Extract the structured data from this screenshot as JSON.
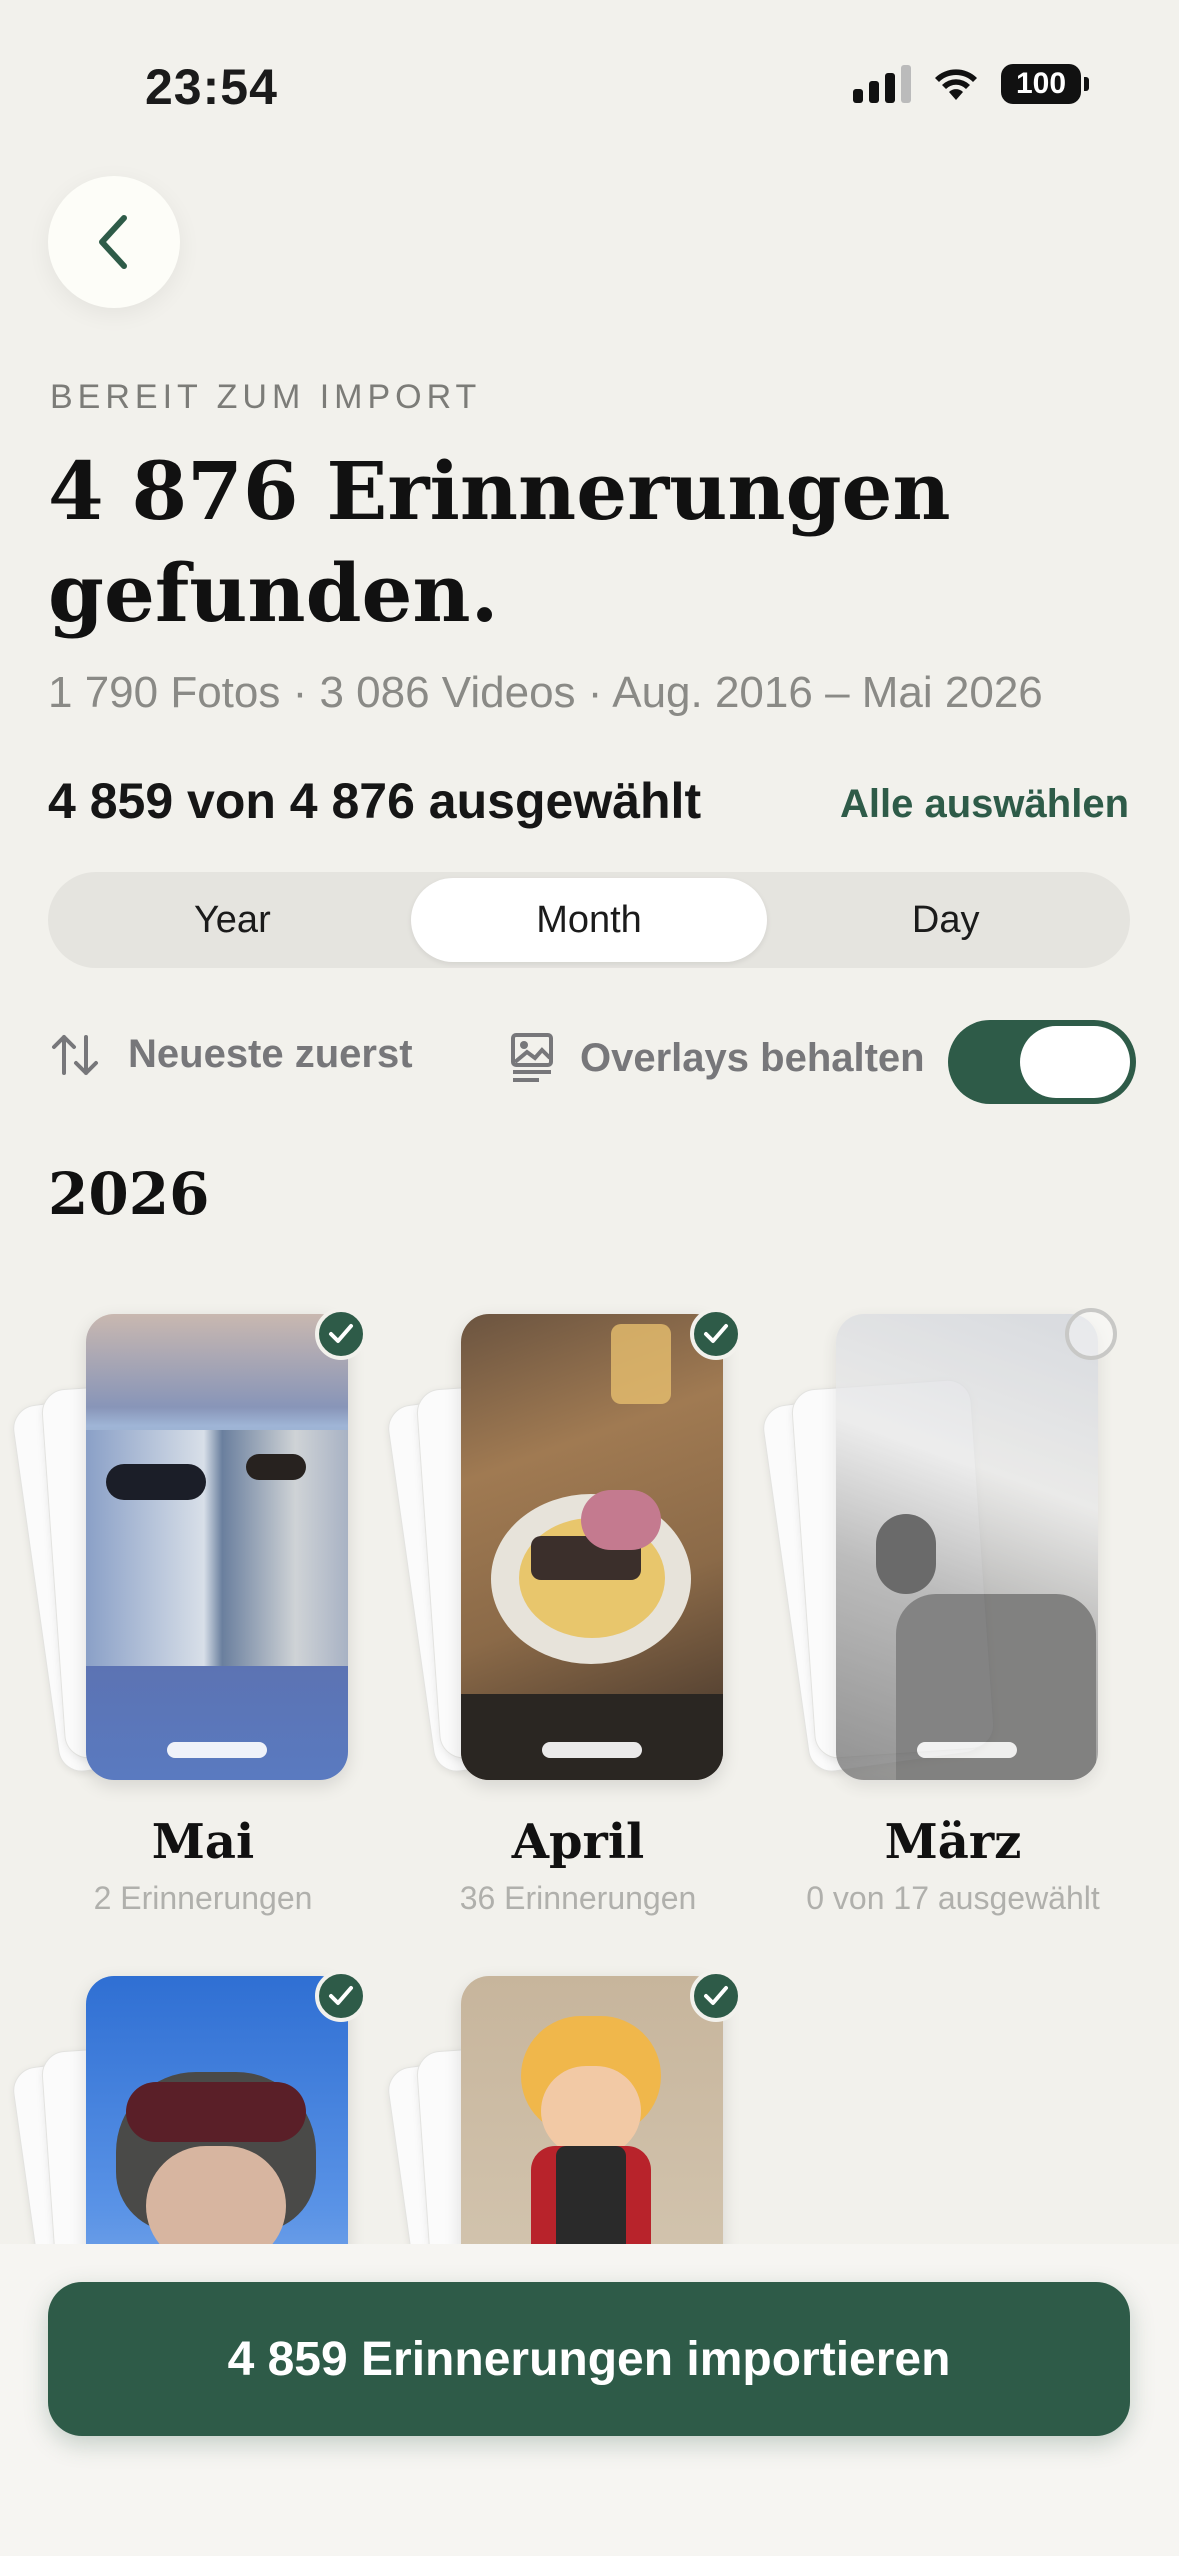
{
  "status": {
    "time": "23:54",
    "battery": "100"
  },
  "header": {
    "eyebrow": "BEREIT ZUM IMPORT",
    "headline": "4 876 Erinnerungen gefunden.",
    "subline": "1 790 Fotos · 3 086 Videos · Aug. 2016 – Mai 2026",
    "selected_count": "4 859 von 4 876 ausgewählt",
    "select_all": "Alle auswählen"
  },
  "segments": {
    "year": "Year",
    "month": "Month",
    "day": "Day",
    "active": "Month"
  },
  "options": {
    "sort_label": "Neueste zuerst",
    "overlay_label": "Overlays behalten",
    "overlay_enabled": true
  },
  "section_year": "2026",
  "months": [
    {
      "title": "Mai",
      "subtitle": "2 Erinnerungen",
      "selected": true
    },
    {
      "title": "April",
      "subtitle": "36 Erinnerungen",
      "selected": true
    },
    {
      "title": "März",
      "subtitle": "0 von 17 ausgewählt",
      "selected": false
    },
    {
      "title": "",
      "subtitle": "",
      "selected": true
    },
    {
      "title": "",
      "subtitle": "",
      "selected": true
    }
  ],
  "import_button": "4 859 Erinnerungen importieren",
  "colors": {
    "accent": "#2e5b48",
    "background": "#f2f1ec"
  },
  "icons": {
    "back": "chevron-left-icon",
    "sort": "sort-arrows-icon",
    "overlay": "photo-overlay-icon",
    "check": "checkmark-icon"
  }
}
